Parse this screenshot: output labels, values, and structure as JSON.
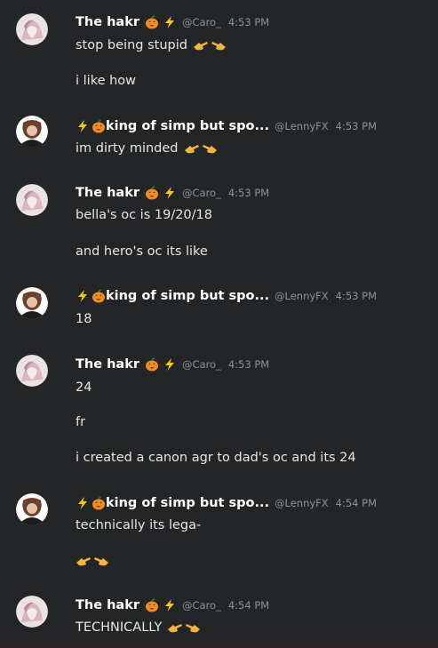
{
  "groups": [
    {
      "user": "The hakr",
      "handle": "@Caro_",
      "time": "4:53 PM",
      "lines": [
        "stop being stupid",
        "i like how"
      ],
      "hands_on": [
        true,
        false
      ]
    },
    {
      "user": "king of simp but spo...",
      "handle": "@LennyFX",
      "time": "4:53 PM",
      "lines": [
        "im dirty minded"
      ],
      "hands_on": [
        true
      ]
    },
    {
      "user": "The hakr",
      "handle": "@Caro_",
      "time": "4:53 PM",
      "lines": [
        "bella's oc is 19/20/18",
        "and hero's oc its like"
      ],
      "hands_on": [
        false,
        false
      ]
    },
    {
      "user": "king of simp but spo...",
      "handle": "@LennyFX",
      "time": "4:53 PM",
      "lines": [
        "18"
      ],
      "hands_on": [
        false
      ]
    },
    {
      "user": "The hakr",
      "handle": "@Caro_",
      "time": "4:53 PM",
      "lines": [
        "24",
        "fr",
        "i created a canon agr to dad's oc and its 24"
      ],
      "hands_on": [
        false,
        false,
        false
      ]
    },
    {
      "user": "king of simp but spo...",
      "handle": "@LennyFX",
      "time": "4:54 PM",
      "lines": [
        "technically its lega-",
        ""
      ],
      "hands_on": [
        false,
        true
      ]
    },
    {
      "user": "The hakr",
      "handle": "@Caro_",
      "time": "4:54 PM",
      "lines": [
        "TECHNICALLY"
      ],
      "hands_on": [
        true
      ]
    }
  ],
  "icons": {
    "pumpkin": "pumpkin-emoji-icon",
    "bolt": "lightning-emoji-icon",
    "hands": "pointing-hands-emoji-icon"
  },
  "colors": {
    "background": "#232527",
    "username": "#ffffff",
    "meta": "#8e9297",
    "text": "#e6e6e6"
  }
}
